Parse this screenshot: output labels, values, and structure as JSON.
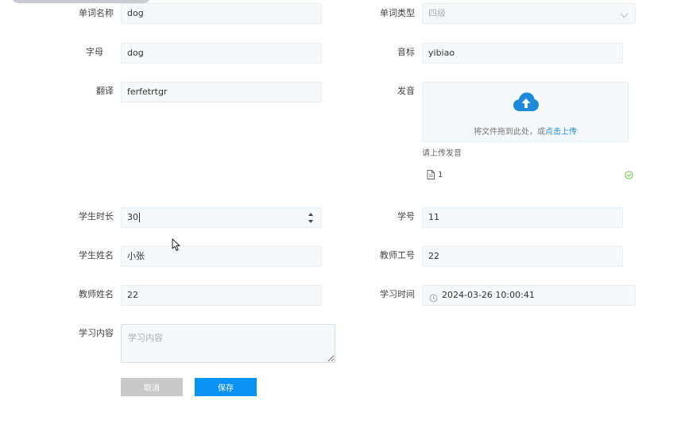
{
  "form": {
    "word_name": {
      "label": "单词名称",
      "value": "dog"
    },
    "word_type": {
      "label": "单词类型",
      "value": "四级"
    },
    "letters": {
      "label": "字母",
      "value": "dog"
    },
    "phonetic": {
      "label": "音标",
      "value": "yibiao"
    },
    "translation": {
      "label": "翻译",
      "value": "ferfetrtgr"
    },
    "pronunciation": {
      "label": "发音",
      "upload_hint_prefix": "将文件拖到此处，或",
      "upload_hint_link": "点击上传",
      "tip": "请上传发音",
      "file_name": "1"
    },
    "study_duration": {
      "label": "学生时长",
      "value": "30"
    },
    "student_id": {
      "label": "学号",
      "value": "11"
    },
    "student_name": {
      "label": "学生姓名",
      "value": "小张"
    },
    "teacher_id": {
      "label": "教师工号",
      "value": "22"
    },
    "teacher_name": {
      "label": "教师姓名",
      "value": "22"
    },
    "study_time": {
      "label": "学习时间",
      "value": "2024-03-26 10:00:41"
    },
    "study_content": {
      "label": "学习内容",
      "placeholder": "学习内容",
      "value": ""
    }
  },
  "buttons": {
    "cancel": "取消",
    "save": "保存"
  },
  "colors": {
    "accent": "#0a93f5",
    "upload_icon": "#1d8ad9",
    "success": "#67c23a",
    "cancel_bg": "#c9c9c9"
  }
}
